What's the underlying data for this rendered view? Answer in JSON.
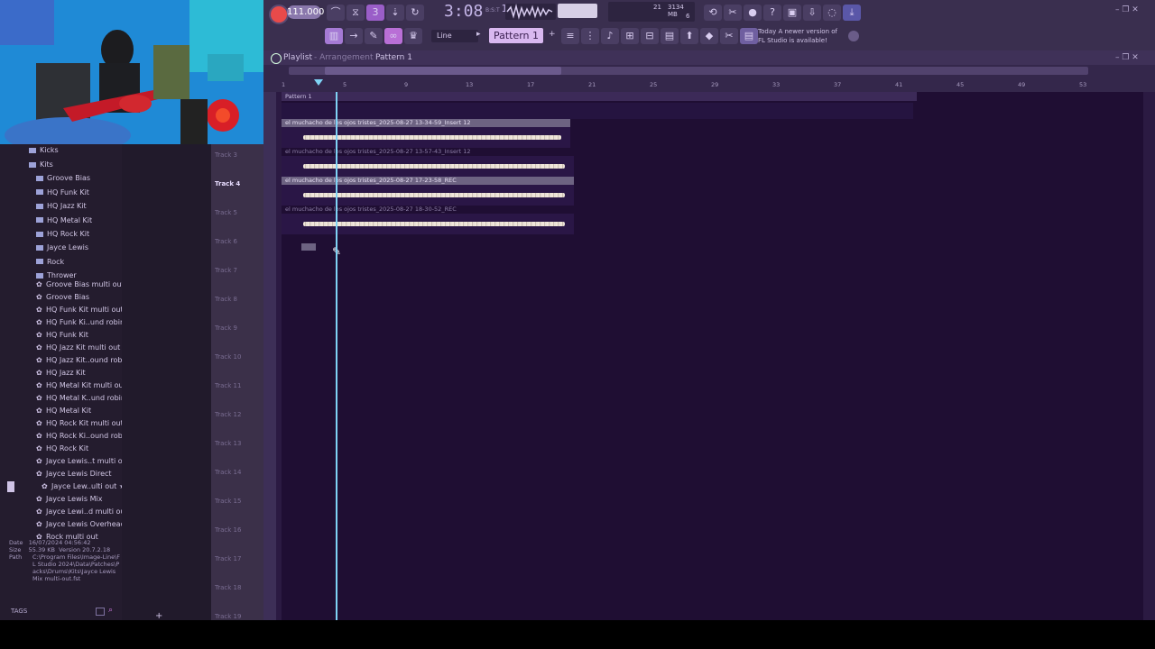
{
  "toolbar": {
    "tempo": "111.000",
    "time": "3:08",
    "time_sub": "14",
    "time_label": "B:S:T",
    "cpu_value": "21",
    "mem_value": "3134 MB",
    "voices": "6",
    "snap": "Line",
    "pattern": "Pattern 1",
    "news_line1": "Today  A newer version of",
    "news_line2": "FL Studio is available!"
  },
  "playlist": {
    "title": "Playlist",
    "subtitle": "Arrangement",
    "pattern": "Pattern 1",
    "ruler": [
      "1",
      "5",
      "9",
      "13",
      "17",
      "21",
      "25",
      "29",
      "33",
      "37",
      "41",
      "45",
      "49",
      "53"
    ],
    "pattern_clip": "Pattern 1",
    "clips": [
      {
        "label": "el muchacho de los ojos tristes_2025-08-27 13-34-59_Insert 12",
        "muted": false
      },
      {
        "label": "el muchacho de los ojos tristes_2025-08-27 13-57-43_Insert 12",
        "muted": true
      },
      {
        "label": "el muchacho de los ojos tristes_2025-08-27 17-23-58_REC",
        "muted": false
      },
      {
        "label": "el muchacho de los ojos tristes_2025-08-27 18-30-52_REC",
        "muted": true
      }
    ]
  },
  "tracks": [
    "Track 3",
    "Track 4",
    "Track 5",
    "Track 6",
    "Track 7",
    "Track 8",
    "Track 9",
    "Track 10",
    "Track 11",
    "Track 12",
    "Track 13",
    "Track 14",
    "Track 15",
    "Track 16",
    "Track 17",
    "Track 18",
    "Track 19"
  ],
  "browser": {
    "folders": [
      "Kicks",
      "Kits",
      "Groove Bias",
      "HQ Funk Kit",
      "HQ Jazz Kit",
      "HQ Metal Kit",
      "HQ Rock Kit",
      "Jayce Lewis",
      "Rock",
      "Thrower"
    ],
    "presets": [
      "Groove Bias multi out",
      "Groove Bias",
      "HQ Funk Kit multi out",
      "HQ Funk Ki..und robin",
      "HQ Funk Kit",
      "HQ Jazz Kit multi out",
      "HQ Jazz Kit..ound robin",
      "HQ Jazz Kit",
      "HQ Metal Kit multi out",
      "HQ Metal K..und robin",
      "HQ Metal Kit",
      "HQ Rock Kit multi out",
      "HQ Rock Ki..ound robin",
      "HQ Rock Kit",
      "Jayce Lewis..t multi out",
      "Jayce Lewis Direct",
      "Jayce Lew..ulti out ★",
      "Jayce Lewis Mix",
      "Jayce Lewi..d multi out",
      "Jayce Lewis Overhead",
      "Rock multi out"
    ],
    "info_date_label": "Date",
    "info_date": "16/07/2024 04:56:42",
    "info_size_label": "Size",
    "info_size": "55.39 KB",
    "info_version": "Version 20.7.2.18",
    "info_path_label": "Path",
    "info_path": "C:\\Program Files\\Image-Line\\FL Studio 2024\\Data\\Patches\\Packs\\Drums\\Kits\\Jayce Lewis Mix multi-out.fst",
    "tags": "TAGS"
  }
}
